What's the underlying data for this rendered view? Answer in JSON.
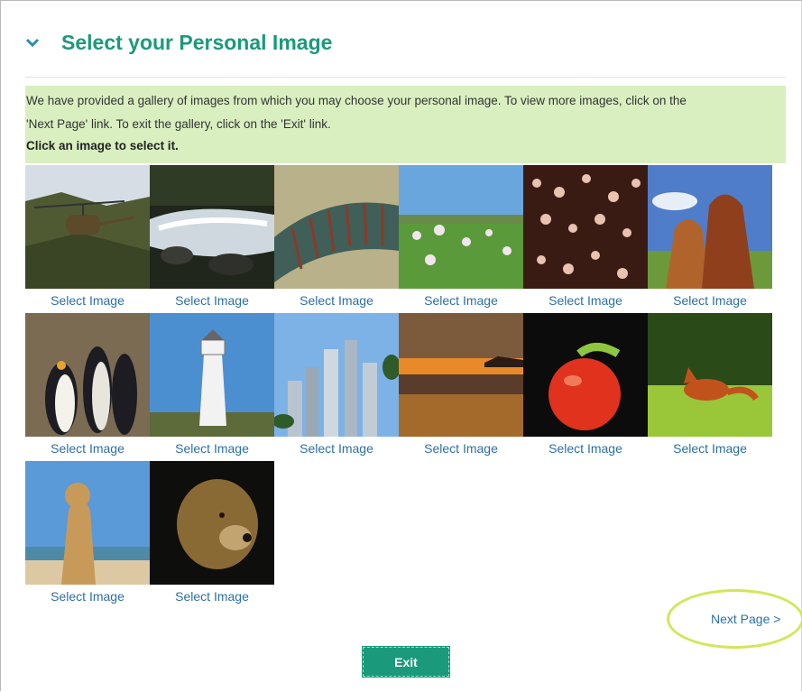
{
  "header": {
    "title": "Select your Personal Image"
  },
  "info": {
    "line1": "We have provided a gallery of images from which you may choose your personal image. To view more images, click on the",
    "line2": "'Next Page' link. To exit the gallery, click on the 'Exit' link.",
    "instruction": "Click an image to select it."
  },
  "gallery": {
    "items": [
      {
        "subject": "helicopter",
        "link": "Select Image"
      },
      {
        "subject": "waterfall-stream",
        "link": "Select Image"
      },
      {
        "subject": "millipede",
        "link": "Select Image"
      },
      {
        "subject": "poppy-field",
        "link": "Select Image"
      },
      {
        "subject": "blossoms",
        "link": "Select Image"
      },
      {
        "subject": "horses",
        "link": "Select Image"
      },
      {
        "subject": "penguins",
        "link": "Select Image"
      },
      {
        "subject": "lighthouse",
        "link": "Select Image"
      },
      {
        "subject": "skyscrapers",
        "link": "Select Image"
      },
      {
        "subject": "sunset-beach",
        "link": "Select Image"
      },
      {
        "subject": "tomato-caterpillar",
        "link": "Select Image"
      },
      {
        "subject": "fox-grass",
        "link": "Select Image"
      },
      {
        "subject": "cat-beach",
        "link": "Select Image"
      },
      {
        "subject": "bear",
        "link": "Select Image"
      }
    ]
  },
  "footer": {
    "next_label": "Next Page >",
    "exit_label": "Exit"
  },
  "colors": {
    "accent": "#1a9a7a",
    "info_bg": "#d9efc0",
    "link": "#2d6fa3",
    "highlight": "#d3e65a"
  }
}
